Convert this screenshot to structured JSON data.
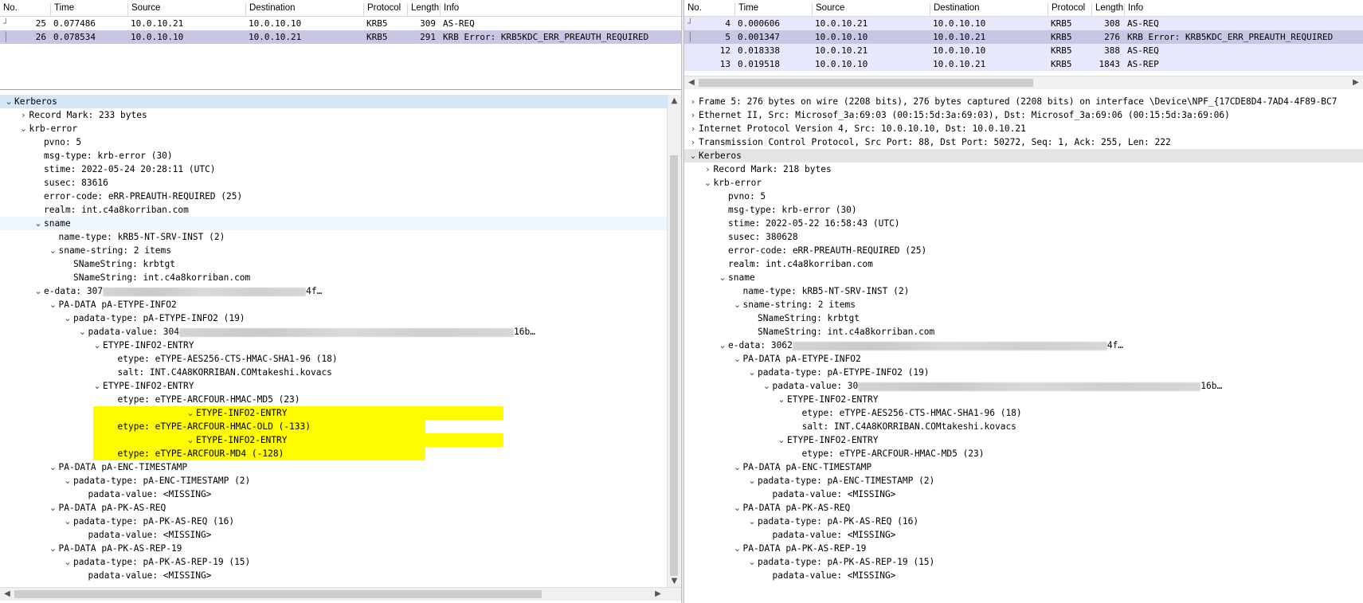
{
  "columns": [
    "No.",
    "Time",
    "Source",
    "Destination",
    "Protocol",
    "Length",
    "Info"
  ],
  "left": {
    "packets": [
      {
        "no": "25",
        "time": "0.077486",
        "src": "10.0.10.21",
        "dst": "10.0.10.10",
        "proto": "KRB5",
        "len": "309",
        "info": "AS-REQ",
        "style": "plain"
      },
      {
        "no": "26",
        "time": "0.078534",
        "src": "10.0.10.10",
        "dst": "10.0.10.21",
        "proto": "KRB5",
        "len": "291",
        "info": "KRB Error: KRB5KDC_ERR_PREAUTH_REQUIRED",
        "style": "sel"
      }
    ],
    "tree": [
      {
        "level": 0,
        "arrow": "down",
        "text": "Kerberos",
        "style": "hdr"
      },
      {
        "level": 1,
        "arrow": "right",
        "text": "Record Mark: 233 bytes"
      },
      {
        "level": 1,
        "arrow": "down",
        "text": "krb-error"
      },
      {
        "level": 2,
        "arrow": "",
        "text": "pvno: 5"
      },
      {
        "level": 2,
        "arrow": "",
        "text": "msg-type: krb-error (30)"
      },
      {
        "level": 2,
        "arrow": "",
        "text": "stime: 2022-05-24 20:28:11 (UTC)"
      },
      {
        "level": 2,
        "arrow": "",
        "text": "susec: 83616"
      },
      {
        "level": 2,
        "arrow": "",
        "text": "error-code: eRR-PREAUTH-REQUIRED (25)"
      },
      {
        "level": 2,
        "arrow": "",
        "text": "realm: int.c4a8korriban.com"
      },
      {
        "level": 2,
        "arrow": "down",
        "text": "sname",
        "style": "softsel"
      },
      {
        "level": 3,
        "arrow": "",
        "text": "name-type: kRB5-NT-SRV-INST (2)"
      },
      {
        "level": 3,
        "arrow": "down",
        "text": "sname-string: 2 items"
      },
      {
        "level": 4,
        "arrow": "",
        "text": "SNameString: krbtgt"
      },
      {
        "level": 4,
        "arrow": "",
        "text": "SNameString: int.c4a8korriban.com"
      },
      {
        "level": 2,
        "arrow": "down",
        "text": "e-data: 307",
        "blur": "255",
        "tail": "4f…"
      },
      {
        "level": 3,
        "arrow": "down",
        "text": "PA-DATA pA-ETYPE-INFO2"
      },
      {
        "level": 4,
        "arrow": "down",
        "text": "padata-type: pA-ETYPE-INFO2 (19)"
      },
      {
        "level": 5,
        "arrow": "down",
        "text": "padata-value: 304",
        "blur": "420",
        "tail": "16b…"
      },
      {
        "level": 6,
        "arrow": "down",
        "text": "ETYPE-INFO2-ENTRY"
      },
      {
        "level": 7,
        "arrow": "",
        "text": "etype: eTYPE-AES256-CTS-HMAC-SHA1-96 (18)"
      },
      {
        "level": 7,
        "arrow": "",
        "text": "salt: INT.C4A8KORRIBAN.COMtakeshi.kovacs"
      },
      {
        "level": 6,
        "arrow": "down",
        "text": "ETYPE-INFO2-ENTRY"
      },
      {
        "level": 7,
        "arrow": "",
        "text": "etype: eTYPE-ARCFOUR-HMAC-MD5 (23)"
      },
      {
        "level": 6,
        "arrow": "down",
        "text": "ETYPE-INFO2-ENTRY",
        "style": "hl"
      },
      {
        "level": 7,
        "arrow": "",
        "text": "etype: eTYPE-ARCFOUR-HMAC-OLD (-133)",
        "style": "hl"
      },
      {
        "level": 6,
        "arrow": "down",
        "text": "ETYPE-INFO2-ENTRY",
        "style": "hl"
      },
      {
        "level": 7,
        "arrow": "",
        "text": "etype: eTYPE-ARCFOUR-MD4 (-128)",
        "style": "hl"
      },
      {
        "level": 3,
        "arrow": "down",
        "text": "PA-DATA pA-ENC-TIMESTAMP"
      },
      {
        "level": 4,
        "arrow": "down",
        "text": "padata-type: pA-ENC-TIMESTAMP (2)"
      },
      {
        "level": 5,
        "arrow": "",
        "text": "padata-value: <MISSING>"
      },
      {
        "level": 3,
        "arrow": "down",
        "text": "PA-DATA pA-PK-AS-REQ"
      },
      {
        "level": 4,
        "arrow": "down",
        "text": "padata-type: pA-PK-AS-REQ (16)"
      },
      {
        "level": 5,
        "arrow": "",
        "text": "padata-value: <MISSING>"
      },
      {
        "level": 3,
        "arrow": "down",
        "text": "PA-DATA pA-PK-AS-REP-19"
      },
      {
        "level": 4,
        "arrow": "down",
        "text": "padata-type: pA-PK-AS-REP-19 (15)"
      },
      {
        "level": 5,
        "arrow": "",
        "text": "padata-value: <MISSING>"
      }
    ]
  },
  "right": {
    "packets": [
      {
        "no": "4",
        "time": "0.000606",
        "src": "10.0.10.21",
        "dst": "10.0.10.10",
        "proto": "KRB5",
        "len": "308",
        "info": "AS-REQ",
        "style": "req"
      },
      {
        "no": "5",
        "time": "0.001347",
        "src": "10.0.10.10",
        "dst": "10.0.10.21",
        "proto": "KRB5",
        "len": "276",
        "info": "KRB Error: KRB5KDC_ERR_PREAUTH_REQUIRED",
        "style": "sel"
      },
      {
        "no": "12",
        "time": "0.018338",
        "src": "10.0.10.21",
        "dst": "10.0.10.10",
        "proto": "KRB5",
        "len": "388",
        "info": "AS-REQ",
        "style": "req"
      },
      {
        "no": "13",
        "time": "0.019518",
        "src": "10.0.10.10",
        "dst": "10.0.10.21",
        "proto": "KRB5",
        "len": "1843",
        "info": "AS-REP",
        "style": "req"
      }
    ],
    "tree": [
      {
        "level": 0,
        "arrow": "right",
        "text": "Frame 5: 276 bytes on wire (2208 bits), 276 bytes captured (2208 bits) on interface \\Device\\NPF_{17CDE8D4-7AD4-4F89-BC7"
      },
      {
        "level": 0,
        "arrow": "right",
        "text": "Ethernet II, Src: Microsof_3a:69:03 (00:15:5d:3a:69:03), Dst: Microsof_3a:69:06 (00:15:5d:3a:69:06)"
      },
      {
        "level": 0,
        "arrow": "right",
        "text": "Internet Protocol Version 4, Src: 10.0.10.10, Dst: 10.0.10.21"
      },
      {
        "level": 0,
        "arrow": "right",
        "text": "Transmission Control Protocol, Src Port: 88, Dst Port: 50272, Seq: 1, Ack: 255, Len: 222"
      },
      {
        "level": 0,
        "arrow": "down",
        "text": "Kerberos",
        "style": "hdrg"
      },
      {
        "level": 1,
        "arrow": "right",
        "text": "Record Mark: 218 bytes"
      },
      {
        "level": 1,
        "arrow": "down",
        "text": "krb-error"
      },
      {
        "level": 2,
        "arrow": "",
        "text": "pvno: 5"
      },
      {
        "level": 2,
        "arrow": "",
        "text": "msg-type: krb-error (30)"
      },
      {
        "level": 2,
        "arrow": "",
        "text": "stime: 2022-05-22 16:58:43 (UTC)"
      },
      {
        "level": 2,
        "arrow": "",
        "text": "susec: 380628"
      },
      {
        "level": 2,
        "arrow": "",
        "text": "error-code: eRR-PREAUTH-REQUIRED (25)"
      },
      {
        "level": 2,
        "arrow": "",
        "text": "realm: int.c4a8korriban.com"
      },
      {
        "level": 2,
        "arrow": "down",
        "text": "sname"
      },
      {
        "level": 3,
        "arrow": "",
        "text": "name-type: kRB5-NT-SRV-INST (2)"
      },
      {
        "level": 3,
        "arrow": "down",
        "text": "sname-string: 2 items"
      },
      {
        "level": 4,
        "arrow": "",
        "text": "SNameString: krbtgt"
      },
      {
        "level": 4,
        "arrow": "",
        "text": "SNameString: int.c4a8korriban.com"
      },
      {
        "level": 2,
        "arrow": "down",
        "text": "e-data: 3062",
        "blur": "395",
        "tail": "4f…"
      },
      {
        "level": 3,
        "arrow": "down",
        "text": "PA-DATA pA-ETYPE-INFO2"
      },
      {
        "level": 4,
        "arrow": "down",
        "text": "padata-type: pA-ETYPE-INFO2 (19)"
      },
      {
        "level": 5,
        "arrow": "down",
        "text": "padata-value: 30",
        "blur": "430",
        "tail": "16b…"
      },
      {
        "level": 6,
        "arrow": "down",
        "text": "ETYPE-INFO2-ENTRY"
      },
      {
        "level": 7,
        "arrow": "",
        "text": "etype: eTYPE-AES256-CTS-HMAC-SHA1-96 (18)"
      },
      {
        "level": 7,
        "arrow": "",
        "text": "salt: INT.C4A8KORRIBAN.COMtakeshi.kovacs"
      },
      {
        "level": 6,
        "arrow": "down",
        "text": "ETYPE-INFO2-ENTRY"
      },
      {
        "level": 7,
        "arrow": "",
        "text": "etype: eTYPE-ARCFOUR-HMAC-MD5 (23)"
      },
      {
        "level": 3,
        "arrow": "down",
        "text": "PA-DATA pA-ENC-TIMESTAMP"
      },
      {
        "level": 4,
        "arrow": "down",
        "text": "padata-type: pA-ENC-TIMESTAMP (2)"
      },
      {
        "level": 5,
        "arrow": "",
        "text": "padata-value: <MISSING>"
      },
      {
        "level": 3,
        "arrow": "down",
        "text": "PA-DATA pA-PK-AS-REQ"
      },
      {
        "level": 4,
        "arrow": "down",
        "text": "padata-type: pA-PK-AS-REQ (16)"
      },
      {
        "level": 5,
        "arrow": "",
        "text": "padata-value: <MISSING>"
      },
      {
        "level": 3,
        "arrow": "down",
        "text": "PA-DATA pA-PK-AS-REP-19"
      },
      {
        "level": 4,
        "arrow": "down",
        "text": "padata-type: pA-PK-AS-REP-19 (15)"
      },
      {
        "level": 5,
        "arrow": "",
        "text": "padata-value: <MISSING>"
      }
    ]
  },
  "colors": {
    "highlight": "#fffb00",
    "selected_packet": "#c7c7e4",
    "kerberos_request": "#e8e8fc",
    "tree_header": "#d6e6f5"
  }
}
